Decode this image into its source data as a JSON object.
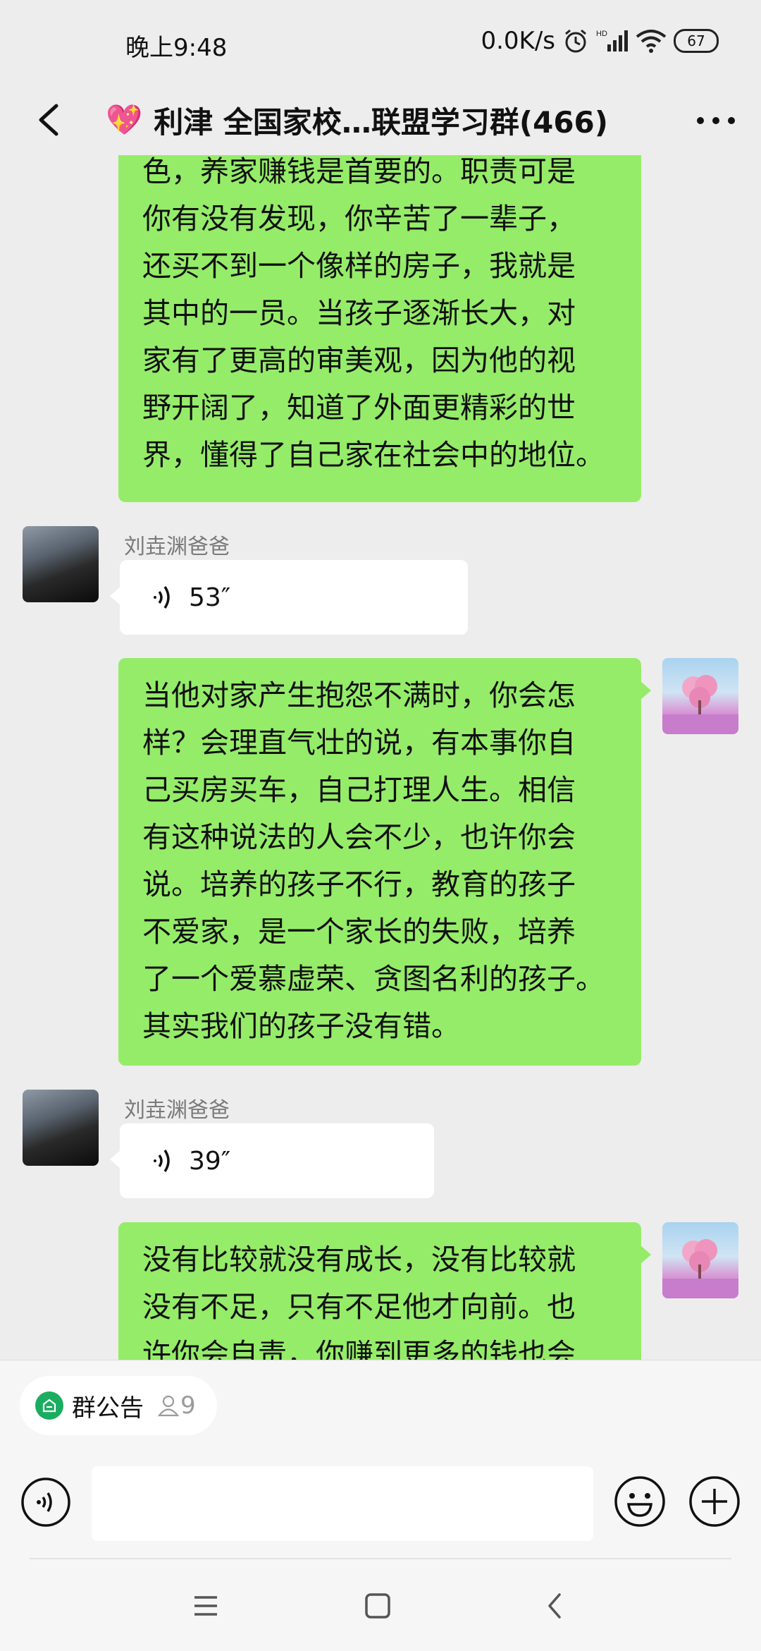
{
  "status_bar": {
    "time": "晚上9:48",
    "speed": "0.0K/s",
    "battery": "67"
  },
  "header": {
    "emoji": "💖",
    "title": "利津 全国家校…联盟学习群(466)"
  },
  "messages": [
    {
      "type": "text",
      "side": "right",
      "lines": [
        "色，养家赚钱是首要的。职责可是",
        "你有没有发现，你辛苦了一辈子，",
        "还买不到一个像样的房子，我就是",
        "其中的一员。当孩子逐渐长大，对",
        "家有了更高的审美观，因为他的视",
        "野开阔了，知道了外面更精彩的世",
        "界，懂得了自己家在社会中的地位。"
      ]
    },
    {
      "type": "voice",
      "side": "left",
      "sender": "刘垚渊爸爸",
      "duration": "53″"
    },
    {
      "type": "text",
      "side": "right",
      "lines": [
        "当他对家产生抱怨不满时，你会怎",
        "样？会理直气壮的说，有本事你自",
        "己买房买车，自己打理人生。相信",
        "有这种说法的人会不少，也许你会",
        "说。培养的孩子不行，教育的孩子",
        "不爱家，是一个家长的失败，培养",
        "了一个爱慕虚荣、贪图名利的孩子。",
        "其实我们的孩子没有错。"
      ]
    },
    {
      "type": "voice",
      "side": "left",
      "sender": "刘垚渊爸爸",
      "duration": "39″"
    },
    {
      "type": "text",
      "side": "right",
      "lines": [
        "没有比较就没有成长，没有比较就",
        "没有不足，只有不足他才向前。也",
        "许你会自责，你赚到更多的钱也会"
      ]
    }
  ],
  "bottom": {
    "notice_label": "群公告",
    "notice_count": "9",
    "input_value": ""
  },
  "icons": {
    "back": "back-arrow-icon",
    "more": "more-dots-icon",
    "voice": "voice-wave-icon",
    "emoji": "emoji-smile-icon",
    "plus": "plus-circle-icon",
    "notice": "announcement-icon",
    "member": "person-icon"
  },
  "colors": {
    "background": "#ededed",
    "bubble_self": "#95ec69",
    "bubble_other": "#ffffff",
    "accent": "#1aad5f"
  }
}
